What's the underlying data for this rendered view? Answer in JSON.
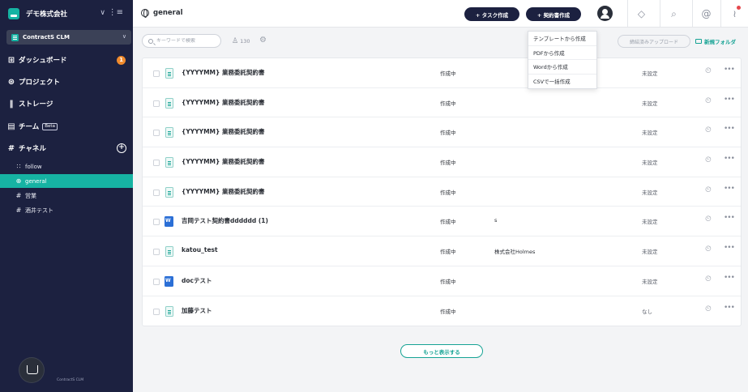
{
  "sidebar": {
    "org_name": "デモ株式会社",
    "product_select": "ContractS CLM",
    "nav": [
      {
        "label": "ダッシュボード",
        "icon": "grid-icon",
        "badge": "1"
      },
      {
        "label": "プロジェクト",
        "icon": "project-icon"
      },
      {
        "label": "ストレージ",
        "icon": "storage-icon"
      },
      {
        "label": "チーム",
        "icon": "team-icon",
        "tag": "Beta"
      },
      {
        "label": "チャネル",
        "icon": "hash-icon"
      }
    ],
    "channels": [
      {
        "label": "follow",
        "icon": "rss-icon"
      },
      {
        "label": "general",
        "icon": "globe-icon",
        "active": true
      },
      {
        "label": "営業",
        "icon": "hash-icon"
      },
      {
        "label": "酒井テスト",
        "icon": "hash-icon"
      }
    ],
    "footer_brand": "ContractS CLM"
  },
  "header": {
    "channel_title": "general",
    "task_button": "+ タスク作成",
    "contract_button": "+ 契約書作成"
  },
  "toolbar": {
    "search_placeholder": "キーワードで検索",
    "member_count": "130",
    "upload_button": "締結済みアップロード",
    "new_folder": "新規フォルダ"
  },
  "dropdown": {
    "items": [
      "テンプレートから作成",
      "PDFから作成",
      "Wordから作成",
      "CSVで一括作成"
    ]
  },
  "rows": [
    {
      "name": "{YYYYMM} 業務委託契約書",
      "status": "作成中",
      "party": "",
      "deadline": "未設定",
      "icon": "generic"
    },
    {
      "name": "{YYYYMM} 業務委託契約書",
      "status": "作成中",
      "party": "",
      "deadline": "未設定",
      "icon": "generic"
    },
    {
      "name": "{YYYYMM} 業務委託契約書",
      "status": "作成中",
      "party": "",
      "deadline": "未設定",
      "icon": "generic"
    },
    {
      "name": "{YYYYMM} 業務委託契約書",
      "status": "作成中",
      "party": "",
      "deadline": "未設定",
      "icon": "generic"
    },
    {
      "name": "{YYYYMM} 業務委託契約書",
      "status": "作成中",
      "party": "",
      "deadline": "未設定",
      "icon": "generic"
    },
    {
      "name": "吉岡テスト契約書dddddd (1)",
      "status": "作成中",
      "party": "s",
      "deadline": "未設定",
      "icon": "word"
    },
    {
      "name": "katou_test",
      "status": "作成中",
      "party": "株式会社Holmes",
      "deadline": "未設定",
      "icon": "generic"
    },
    {
      "name": "docテスト",
      "status": "作成中",
      "party": "",
      "deadline": "未設定",
      "icon": "word"
    },
    {
      "name": "加藤テスト",
      "status": "作成中",
      "party": "",
      "deadline": "なし",
      "icon": "generic"
    }
  ],
  "show_more": "もっと表示する"
}
